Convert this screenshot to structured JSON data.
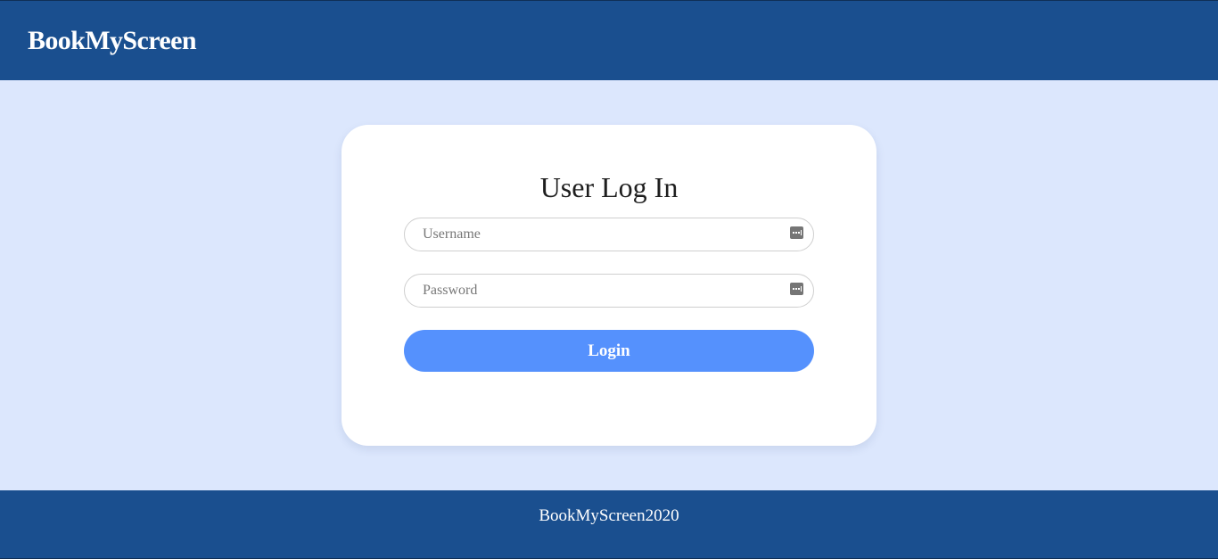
{
  "header": {
    "brand": "BookMyScreen"
  },
  "login_card": {
    "title": "User Log In",
    "username": {
      "placeholder": "Username",
      "value": "",
      "icon": "password-manager-icon"
    },
    "password": {
      "placeholder": "Password",
      "value": "",
      "icon": "password-manager-icon"
    },
    "login_label": "Login"
  },
  "footer": {
    "text": "BookMyScreen2020"
  },
  "colors": {
    "header_bg": "#1a4f8f",
    "page_bg": "#dce7fd",
    "button_bg": "#5591fd",
    "card_bg": "#ffffff"
  }
}
